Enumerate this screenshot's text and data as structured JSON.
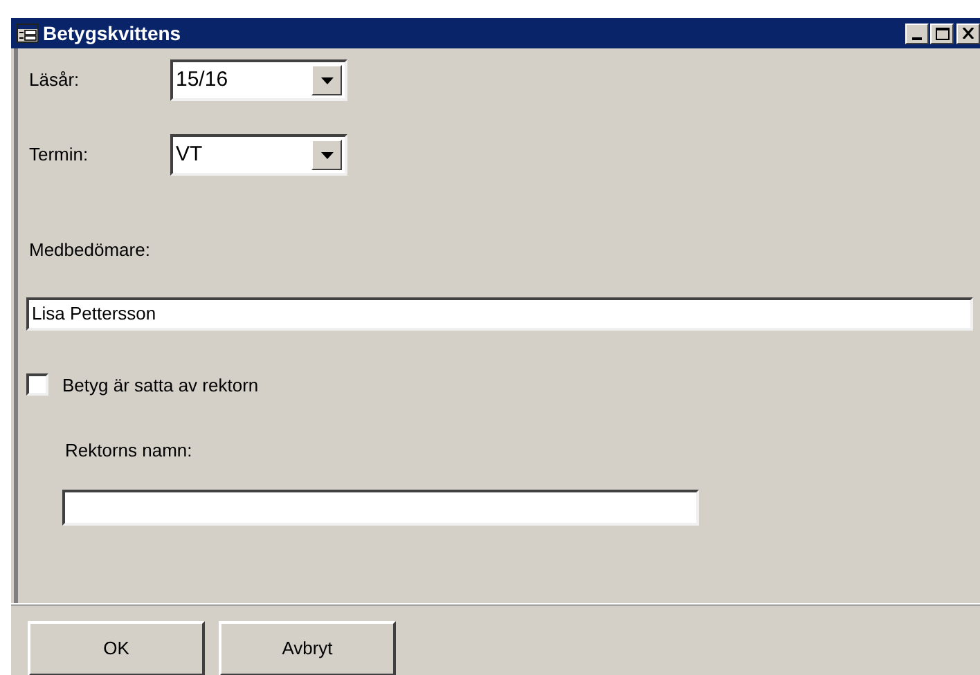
{
  "window": {
    "title": "Betygskvittens"
  },
  "fields": [
    {
      "kind": "combo",
      "label": "Läsår:",
      "value": "15/16"
    },
    {
      "kind": "combo",
      "label": "Termin:",
      "value": "VT"
    }
  ],
  "medbedomare": {
    "label": "Medbedömare:",
    "value": "Lisa Pettersson"
  },
  "checkbox": {
    "label": "Betyg är satta av rektorn",
    "checked": false
  },
  "rektor": {
    "label": "Rektorns namn:"
  },
  "buttons": [
    "OK",
    "Avbryt"
  ]
}
